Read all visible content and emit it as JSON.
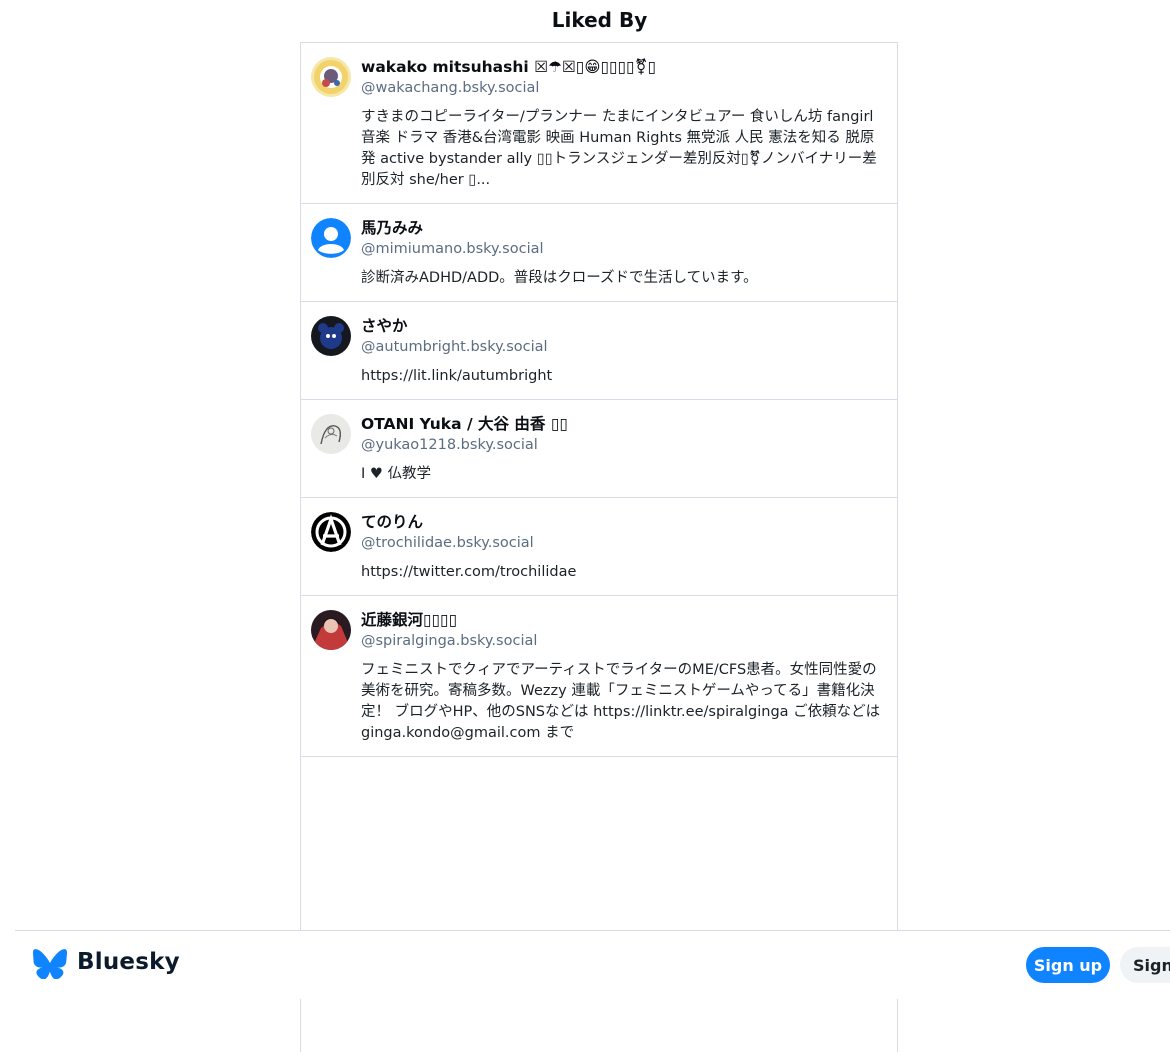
{
  "page": {
    "title": "Liked By"
  },
  "likes": [
    {
      "name": "wakako mitsuhashi ☒☂☒▯😁▯▯▯▯⚧▯",
      "handle": "@wakachang.bsky.social",
      "bio": "すきまのコピーライター/プランナー たまにインタビュアー 食いしん坊 fangirl 音楽 ドラマ 香港&台湾電影 映画 Human Rights 無党派 人民 憲法を知る 脱原発 active bystander ally ▯▯トランスジェンダー差別反対▯⚧ノンバイナリー差別反対 she/her ▯...",
      "avatar_icon": "flower-avatar-icon"
    },
    {
      "name": "馬乃みみ",
      "handle": "@mimiumano.bsky.social",
      "bio": "診断済みADHD/ADD。普段はクローズドで生活しています。",
      "avatar_icon": "default-user-avatar-icon"
    },
    {
      "name": "さやか",
      "handle": "@autumbright.bsky.social",
      "bio": "https://lit.link/autumbright",
      "avatar_icon": "blue-bear-avatar-icon"
    },
    {
      "name": "OTANI Yuka / 大谷 由香 ▯▯",
      "handle": "@yukao1218.bsky.social",
      "bio": "I ♥ 仏教学",
      "avatar_icon": "sketch-avatar-icon"
    },
    {
      "name": "てのりん",
      "handle": "@trochilidae.bsky.social",
      "bio": "https://twitter.com/trochilidae",
      "avatar_icon": "anarchy-symbol-avatar-icon"
    },
    {
      "name": "近藤銀河▯▯▯▯",
      "handle": "@spiralginga.bsky.social",
      "bio": "フェミニストでクィアでアーティストでライターのME/CFS患者。女性同性愛の美術を研究。寄稿多数。Wezzy 連載「フェミニストゲームやってる」書籍化決定！ ブログやHP、他のSNSなどは https://linktr.ee/spiralginga ご依頼などはginga.kondo@gmail.com まで",
      "avatar_icon": "photo-avatar-icon"
    }
  ],
  "footer": {
    "brand": "Bluesky",
    "signup_label": "Sign up",
    "signin_label": "Sign in",
    "brand_color": "#1083fe"
  }
}
